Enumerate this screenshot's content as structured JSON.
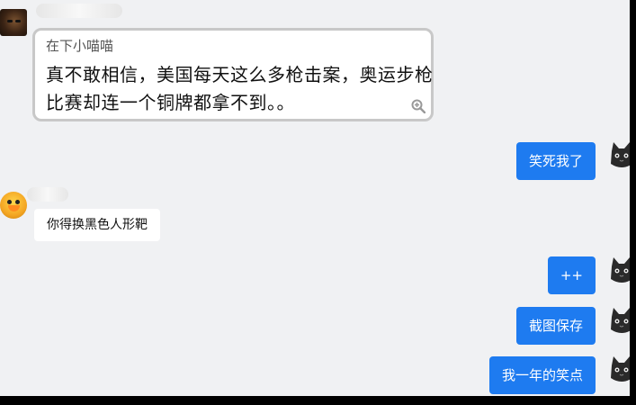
{
  "chat": {
    "top_time": "...",
    "quoted_message": {
      "sender": "在下小喵喵",
      "text": "真不敢相信，美国每天这么多枪击案，奥运步枪比赛却连一个铜牌都拿不到。。"
    },
    "outgoing": [
      {
        "text": "笑死我了"
      },
      {
        "text": "++"
      },
      {
        "text": "截图保存"
      },
      {
        "text": "我一年的笑点"
      }
    ],
    "incoming": [
      {
        "text": "你得换黑色人形靶"
      }
    ]
  },
  "colors": {
    "outgoing_bubble": "#1e7bf0",
    "incoming_bubble": "#ffffff",
    "background": "#f0f1f3"
  },
  "icons": [
    "zoom-in-icon",
    "cat-avatar"
  ]
}
